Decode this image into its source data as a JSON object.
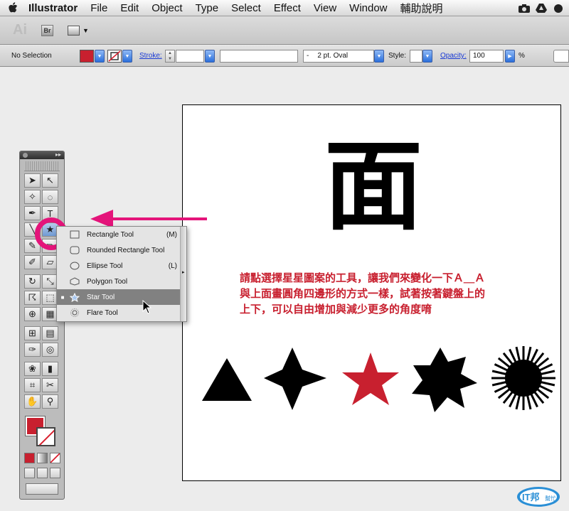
{
  "menubar": {
    "app": "Illustrator",
    "items": [
      "File",
      "Edit",
      "Object",
      "Type",
      "Select",
      "Effect",
      "View",
      "Window",
      "輔助說明"
    ]
  },
  "appbar": {
    "logo": "Ai",
    "bridge": "Br"
  },
  "control": {
    "selection": "No Selection",
    "stroke_label": "Stroke:",
    "brush_value": "2 pt. Oval",
    "brush_prefix": "-",
    "style_label": "Style:",
    "opacity_label": "Opacity:",
    "opacity_value": "100",
    "percent": "%"
  },
  "colors": {
    "accent_red": "#c8202f",
    "highlight_pink": "#e4147a"
  },
  "artboard": {
    "glyph": "面",
    "instruction_lines": [
      "請點選擇星星圖案的工具，讓我們來變化一下Ａ＿Ａ",
      "與上面畫圓角四邊形的方式一樣，試著按著鍵盤上的",
      "上下，可以自由增加與減少更多的角度唷"
    ]
  },
  "flyout": {
    "items": [
      {
        "label": "Rectangle Tool",
        "shortcut": "(M)",
        "icon": "rectangle-icon"
      },
      {
        "label": "Rounded Rectangle Tool",
        "shortcut": "",
        "icon": "rounded-rectangle-icon"
      },
      {
        "label": "Ellipse Tool",
        "shortcut": "(L)",
        "icon": "ellipse-icon"
      },
      {
        "label": "Polygon Tool",
        "shortcut": "",
        "icon": "polygon-icon"
      },
      {
        "label": "Star Tool",
        "shortcut": "",
        "icon": "star-icon",
        "active": true
      },
      {
        "label": "Flare Tool",
        "shortcut": "",
        "icon": "flare-icon"
      }
    ],
    "active_mark": "■"
  },
  "tools": [
    {
      "name": "selection-tool-icon",
      "glyph": "➤"
    },
    {
      "name": "direct-selection-tool-icon",
      "glyph": "↖"
    },
    {
      "name": "magic-wand-tool-icon",
      "glyph": "✧"
    },
    {
      "name": "lasso-tool-icon",
      "glyph": "◌"
    },
    {
      "name": "pen-tool-icon",
      "glyph": "✒"
    },
    {
      "name": "type-tool-icon",
      "glyph": "T"
    },
    {
      "name": "line-tool-icon",
      "glyph": "╲"
    },
    {
      "name": "star-tool-icon",
      "glyph": "★"
    },
    {
      "name": "paintbrush-tool-icon",
      "glyph": "✎"
    },
    {
      "name": "pencil-tool-icon",
      "glyph": "✏"
    },
    {
      "name": "blob-brush-tool-icon",
      "glyph": "✐"
    },
    {
      "name": "eraser-tool-icon",
      "glyph": "▱"
    },
    {
      "name": "rotate-tool-icon",
      "glyph": "↻"
    },
    {
      "name": "scale-tool-icon",
      "glyph": "⤡"
    },
    {
      "name": "warp-tool-icon",
      "glyph": "☈"
    },
    {
      "name": "free-transform-tool-icon",
      "glyph": "⬚"
    },
    {
      "name": "shape-builder-tool-icon",
      "glyph": "⊕"
    },
    {
      "name": "perspective-grid-tool-icon",
      "glyph": "▦"
    },
    {
      "name": "mesh-tool-icon",
      "glyph": "⊞"
    },
    {
      "name": "gradient-tool-icon",
      "glyph": "▤"
    },
    {
      "name": "eyedropper-tool-icon",
      "glyph": "✑"
    },
    {
      "name": "blend-tool-icon",
      "glyph": "◎"
    },
    {
      "name": "symbol-sprayer-tool-icon",
      "glyph": "❀"
    },
    {
      "name": "column-graph-tool-icon",
      "glyph": "▮"
    },
    {
      "name": "artboard-tool-icon",
      "glyph": "⌗"
    },
    {
      "name": "slice-tool-icon",
      "glyph": "✂"
    },
    {
      "name": "hand-tool-icon",
      "glyph": "✋"
    },
    {
      "name": "zoom-tool-icon",
      "glyph": "⚲"
    }
  ],
  "shapes": [
    {
      "name": "triangle-shape",
      "color": "#000000"
    },
    {
      "name": "four-point-star-shape",
      "color": "#000000"
    },
    {
      "name": "five-point-star-shape",
      "color": "#c8202f"
    },
    {
      "name": "seven-point-star-shape",
      "color": "#000000"
    },
    {
      "name": "burst-star-shape",
      "color": "#000000"
    }
  ],
  "watermark": {
    "text": "IT邦",
    "sub": "幫忙"
  }
}
